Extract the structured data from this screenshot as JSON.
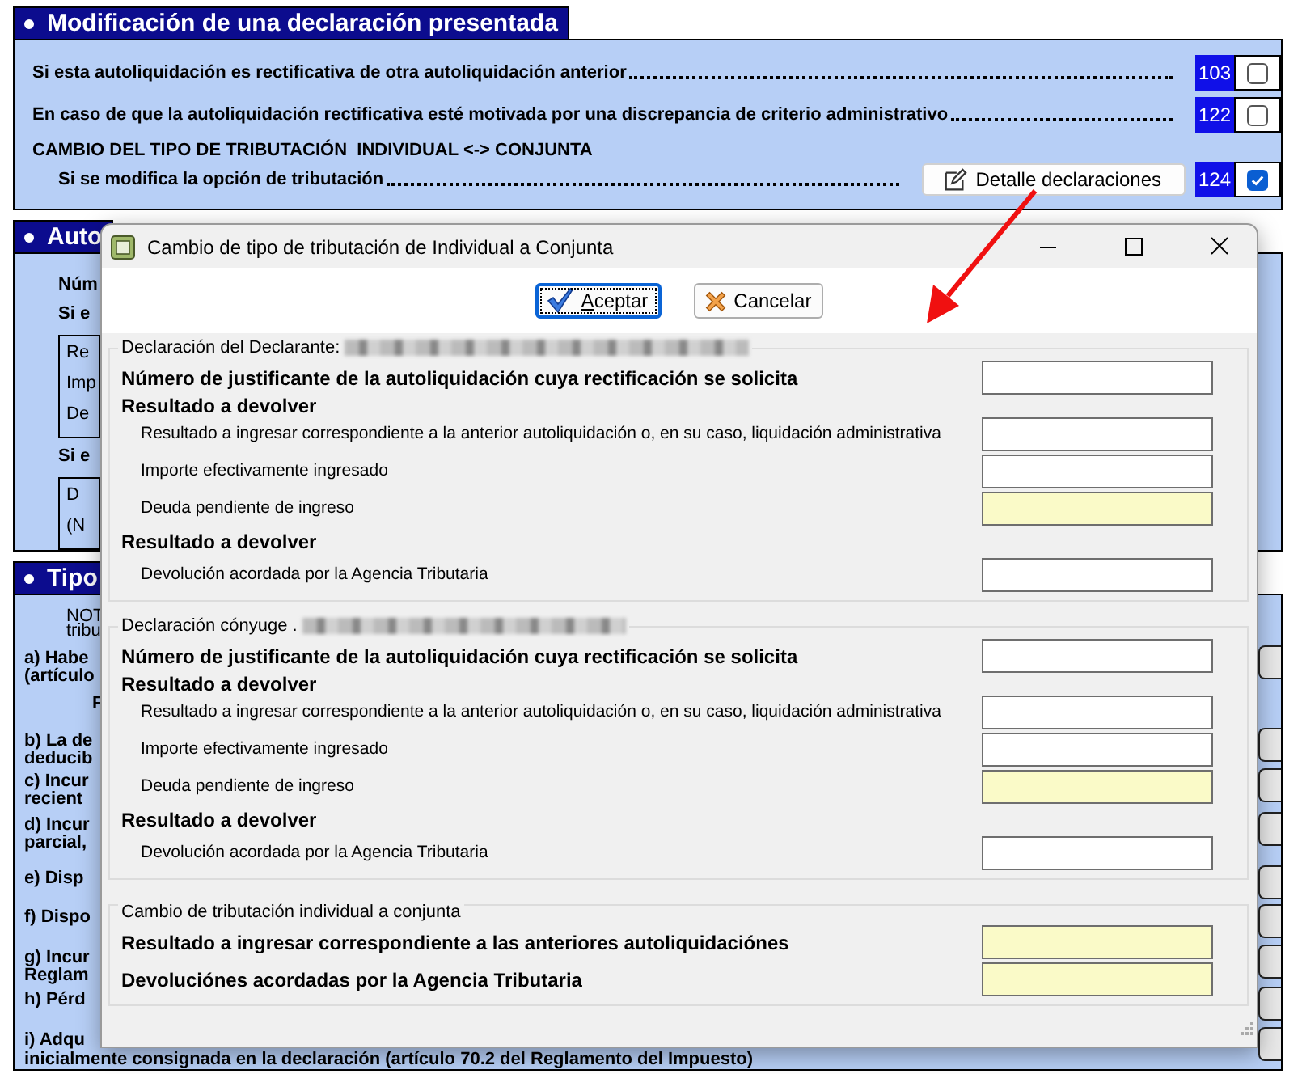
{
  "modification": {
    "title": "Modificación de una declaración presentada",
    "rows": [
      {
        "kind": "check",
        "label": "Si esta autoliquidación es rectificativa de otra autoliquidación anterior",
        "code": "103",
        "checked": false
      },
      {
        "kind": "check",
        "label": "En caso de que la autoliquidación rectificativa esté motivada por una discrepancia de criterio administrativo",
        "code": "122",
        "checked": false
      },
      {
        "kind": "heading",
        "label": "CAMBIO DEL TIPO DE TRIBUTACIÓN  INDIVIDUAL <-> CONJUNTA"
      },
      {
        "kind": "check",
        "label": "Si se modifica la opción de tributación",
        "code": "124",
        "checked": true,
        "button": "Detalle declaraciones"
      }
    ]
  },
  "rectificativa": {
    "title": "Auto",
    "items": [
      {
        "kind": "label",
        "lines": [
          "Núm"
        ]
      },
      {
        "kind": "label",
        "lines": [
          "Si e"
        ]
      },
      {
        "kind": "group",
        "lines": [
          "Re",
          "Imp",
          "De"
        ]
      },
      {
        "kind": "label",
        "lines": [
          "Si e"
        ]
      },
      {
        "kind": "group",
        "lines": [
          "D",
          "(N"
        ]
      }
    ]
  },
  "tipo": {
    "title": "Tipo",
    "items": [
      {
        "kind": "note",
        "lines": [
          "NOT",
          "tribu"
        ]
      },
      {
        "kind": "option",
        "lines": [
          "a) Habe",
          "(artículo"
        ],
        "checked": false
      },
      {
        "kind": "indent",
        "lines": [
          "F"
        ]
      },
      {
        "kind": "option",
        "lines": [
          "b) La de",
          "deducib"
        ],
        "checked": false
      },
      {
        "kind": "option",
        "lines": [
          "c) Incur",
          "recient"
        ],
        "checked": false
      },
      {
        "kind": "option",
        "lines": [
          "d) Incur",
          "parcial,"
        ],
        "checked": false
      },
      {
        "kind": "option",
        "lines": [
          "e) Disp"
        ],
        "checked": false
      },
      {
        "kind": "option",
        "lines": [
          "f) Dispo"
        ],
        "checked": false
      },
      {
        "kind": "option",
        "lines": [
          "g) Incur",
          "Reglam"
        ],
        "checked": false
      },
      {
        "kind": "option",
        "lines": [
          "h) Pérd"
        ],
        "checked": false
      },
      {
        "kind": "option",
        "lines": [
          "i) Adqu"
        ],
        "checked": false
      }
    ],
    "footer": "inicialmente consignada en la declaración (artículo 70.2 del Reglamento del Impuesto)"
  },
  "dialog": {
    "title": "Cambio de tipo de tributación de Individual a Conjunta",
    "buttons": [
      {
        "kind": "accept",
        "label": "Aceptar",
        "focused": true
      },
      {
        "kind": "cancel",
        "label": "Cancelar",
        "focused": false
      }
    ],
    "groups": [
      {
        "legend": "Declaración del Declarante:",
        "redacted": true,
        "rows": [
          {
            "kind": "bold",
            "label": "Número de justificante de la autoliquidación cuya rectificación se solicita",
            "readonly": false
          },
          {
            "kind": "heading",
            "label": "Resultado a devolver"
          },
          {
            "kind": "sub",
            "label": "Resultado a ingresar correspondiente a la anterior autoliquidación o, en su caso, liquidación administrativa",
            "readonly": false
          },
          {
            "kind": "sub",
            "label": "Importe efectivamente ingresado",
            "readonly": false
          },
          {
            "kind": "sub",
            "label": "Deuda pendiente de ingreso",
            "readonly": true
          },
          {
            "kind": "heading",
            "label": "Resultado a devolver"
          },
          {
            "kind": "sub",
            "label": "Devolución acordada por la Agencia Tributaria",
            "readonly": false
          }
        ]
      },
      {
        "legend": "Declaración cónyuge .",
        "redacted": true,
        "rows": [
          {
            "kind": "bold",
            "label": "Número de justificante de la autoliquidación cuya rectificación se solicita",
            "readonly": false
          },
          {
            "kind": "heading",
            "label": "Resultado a devolver"
          },
          {
            "kind": "sub",
            "label": "Resultado a ingresar correspondiente a la anterior autoliquidación o, en su caso, liquidación administrativa",
            "readonly": false
          },
          {
            "kind": "sub",
            "label": "Importe efectivamente ingresado",
            "readonly": false
          },
          {
            "kind": "sub",
            "label": "Deuda pendiente de ingreso",
            "readonly": true
          },
          {
            "kind": "heading",
            "label": "Resultado a devolver"
          },
          {
            "kind": "sub",
            "label": "Devolución acordada por la Agencia Tributaria",
            "readonly": false
          }
        ]
      },
      {
        "legend": "Cambio de tributación individual a conjunta",
        "redacted": false,
        "rows": [
          {
            "kind": "bold",
            "label": "Resultado a ingresar correspondiente a las anteriores autoliquidaciónes",
            "readonly": true
          },
          {
            "kind": "bold",
            "label": "Devoluciónes acordadas por la Agencia Tributaria",
            "readonly": true
          }
        ]
      }
    ]
  }
}
